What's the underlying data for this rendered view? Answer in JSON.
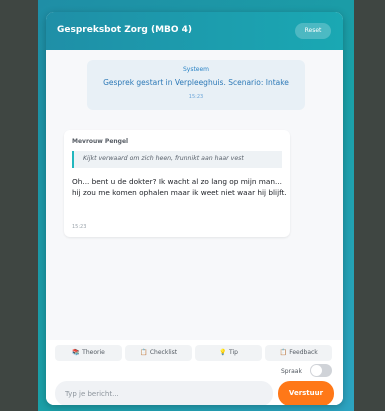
{
  "header": {
    "title": "Gespreksbot Zorg (MBO 4)",
    "reset_label": "Reset"
  },
  "system_message": {
    "title": "Systeem",
    "text": "Gesprek gestart in Verpleeghuis. Scenario: Intake",
    "time": "15:23"
  },
  "incoming_message": {
    "sender": "Mevrouw Pengel",
    "action": "Kijkt verwaard om zich heen, frunnikt aan haar vest",
    "text": "Oh... bent u de dokter? Ik wacht al zo lang op mijn man... hij zou me komen ophalen maar ik weet niet waar hij blijft.",
    "time": "15:23"
  },
  "quick_actions": [
    {
      "icon": "📚",
      "icon_name": "books-icon",
      "label": "Theorie"
    },
    {
      "icon": "📋",
      "icon_name": "clipboard-icon",
      "label": "Checklist"
    },
    {
      "icon": "💡",
      "icon_name": "lightbulb-icon",
      "label": "Tip"
    },
    {
      "icon": "📋",
      "icon_name": "clipboard-icon",
      "label": "Feedback"
    }
  ],
  "speech": {
    "label": "Spraak",
    "enabled": false
  },
  "composer": {
    "placeholder": "Typ je bericht...",
    "send_label": "Verstuur"
  },
  "colors": {
    "accent": "#1aa8b3",
    "send_button": "#ff7818",
    "system_text": "#2d79b7"
  }
}
